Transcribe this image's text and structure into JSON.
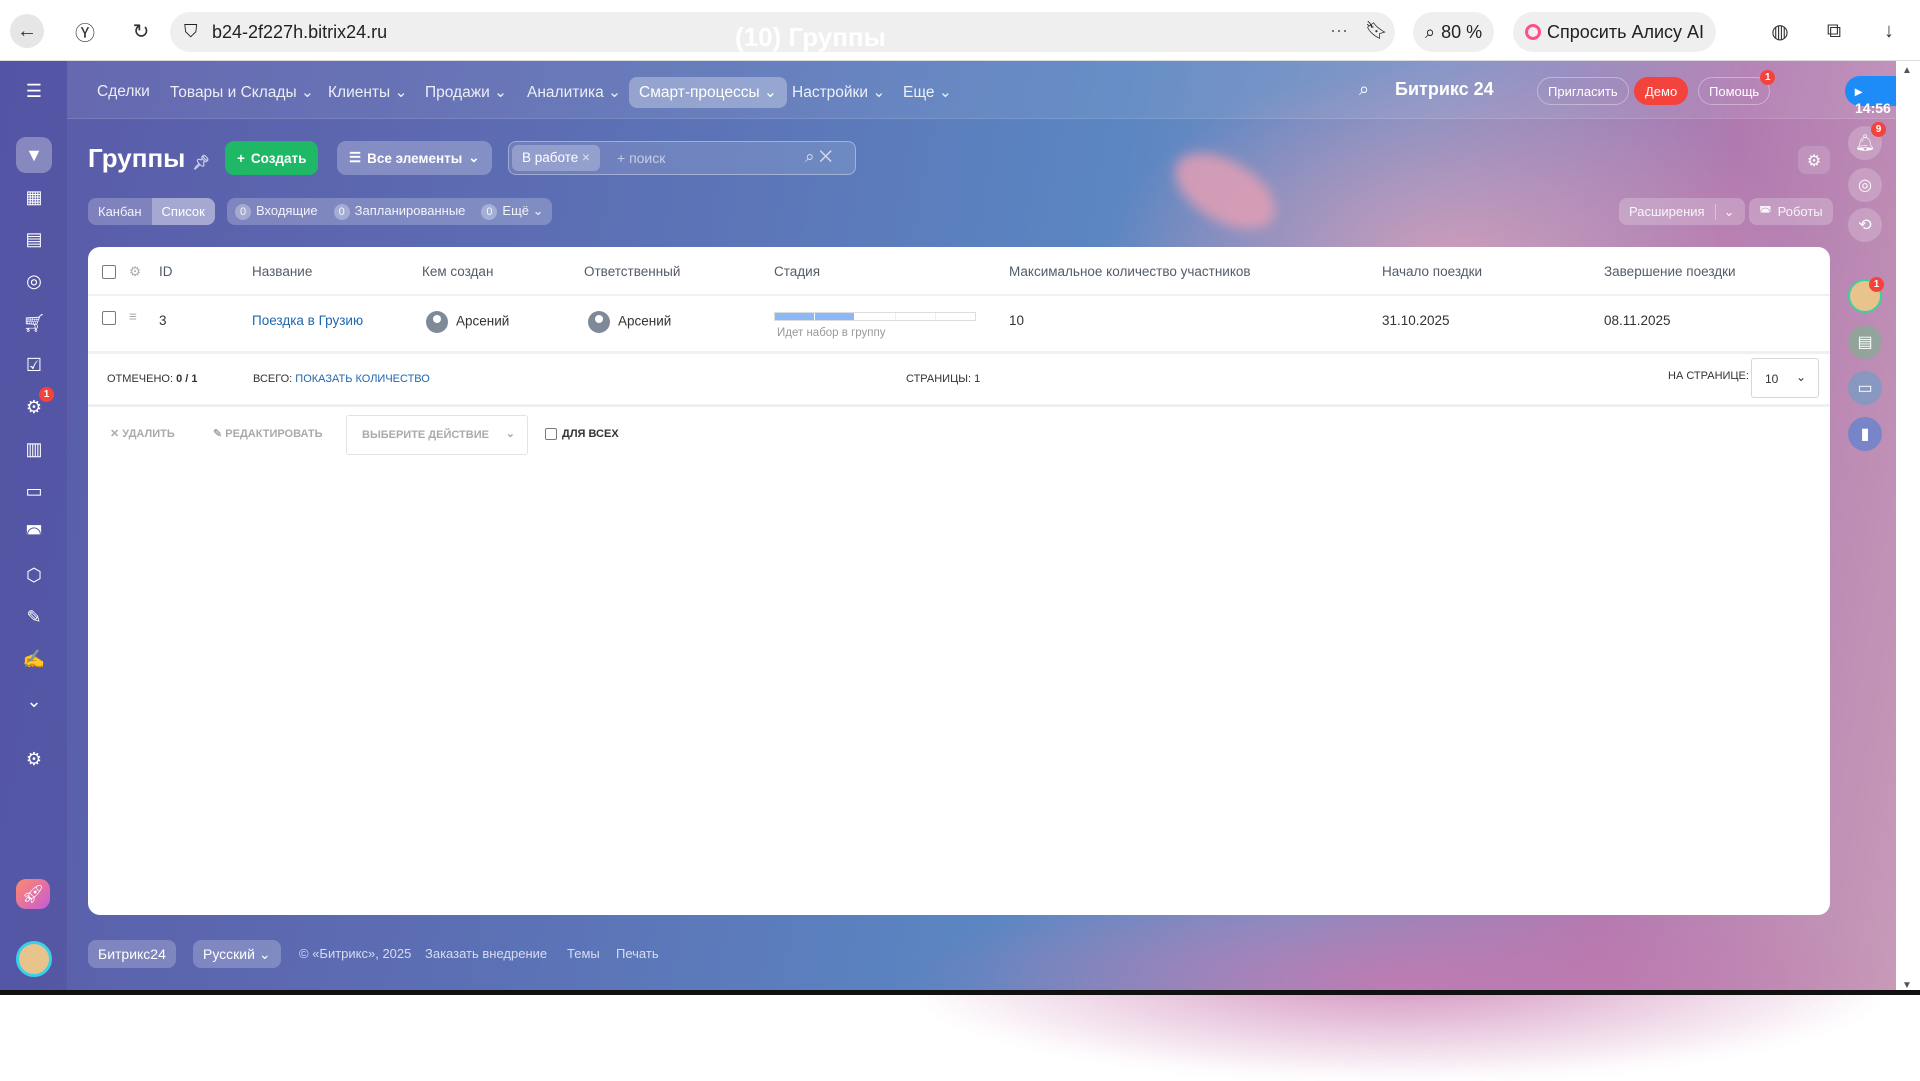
{
  "browser": {
    "host": "b24-2f227h.bitrix24.ru",
    "tab_title": "(10) Группы",
    "zoom": "80 %",
    "alice": "Спросить Алису AI"
  },
  "nav": {
    "items": [
      "Сделки",
      "Товары и Склады",
      "Клиенты",
      "Продажи",
      "Аналитика",
      "Смарт-процессы",
      "Настройки",
      "Еще"
    ],
    "active": "Смарт-процессы"
  },
  "header": {
    "brand": "Битрикс 24",
    "invite": "Пригласить",
    "demo": "Демо",
    "help": "Помощь",
    "help_badge": "1",
    "time": "14:56",
    "notif_badge": "9",
    "chat_badge": "1",
    "sidebar_badge": "1"
  },
  "page": {
    "title": "Группы",
    "create": "Создать",
    "all_items": "Все элементы",
    "filter_tag": "В работе",
    "search_placeholder": "+ поиск",
    "views": [
      "Канбан",
      "Список"
    ],
    "counters": [
      {
        "n": "0",
        "label": "Входящие"
      },
      {
        "n": "0",
        "label": "Запланированные"
      },
      {
        "n": "0",
        "label": "Ещё"
      }
    ],
    "extensions": "Расширения",
    "robots": "Роботы"
  },
  "table": {
    "columns": [
      "ID",
      "Название",
      "Кем создан",
      "Ответственный",
      "Стадия",
      "Максимальное количество участников",
      "Начало поездки",
      "Завершение поездки"
    ],
    "rows": [
      {
        "id": "3",
        "name": "Поездка в Грузию",
        "created_by": "Арсений",
        "responsible": "Арсений",
        "stage": "Идет набор в группу",
        "stage_progress": "2/5",
        "max": "10",
        "start": "31.10.2025",
        "end": "08.11.2025"
      }
    ],
    "marked_label": "ОТМЕЧЕНО:",
    "marked": "0 / 1",
    "total_label": "ВСЕГО:",
    "total_link": "ПОКАЗАТЬ КОЛИЧЕСТВО",
    "pages_label": "СТРАНИЦЫ:",
    "pages": "1",
    "per_page_label": "НА СТРАНИЦЕ:",
    "per_page": "10"
  },
  "actions": {
    "delete": "УДАЛИТЬ",
    "edit": "РЕДАКТИРОВАТЬ",
    "choose": "ВЫБЕРИТЕ ДЕЙСТВИЕ",
    "for_all": "ДЛЯ ВСЕХ"
  },
  "footer": {
    "brand": "Битрикс24",
    "lang": "Русский",
    "copyright": "© «Битрикс», 2025",
    "order": "Заказать внедрение",
    "themes": "Темы",
    "print": "Печать"
  }
}
